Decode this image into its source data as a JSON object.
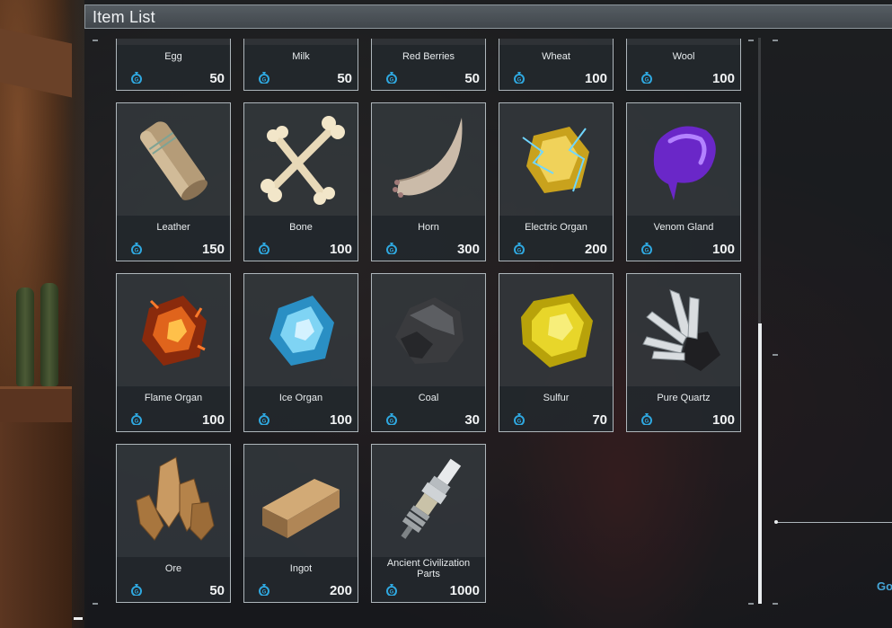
{
  "window": {
    "title": "Item List"
  },
  "colors": {
    "coin": "#2fa8e0",
    "card_border": "#aeb6bb",
    "text": "#e8ecee"
  },
  "right_panel": {
    "partial_text": "Go"
  },
  "items": [
    {
      "name": "Egg",
      "price": "50",
      "icon": "egg-icon"
    },
    {
      "name": "Milk",
      "price": "50",
      "icon": "milk-icon"
    },
    {
      "name": "Red Berries",
      "price": "50",
      "icon": "red-berries-icon"
    },
    {
      "name": "Wheat",
      "price": "100",
      "icon": "wheat-icon"
    },
    {
      "name": "Wool",
      "price": "100",
      "icon": "wool-icon"
    },
    {
      "name": "Leather",
      "price": "150",
      "icon": "leather-icon"
    },
    {
      "name": "Bone",
      "price": "100",
      "icon": "bone-icon"
    },
    {
      "name": "Horn",
      "price": "300",
      "icon": "horn-icon"
    },
    {
      "name": "Electric Organ",
      "price": "200",
      "icon": "electric-organ-icon"
    },
    {
      "name": "Venom Gland",
      "price": "100",
      "icon": "venom-gland-icon"
    },
    {
      "name": "Flame Organ",
      "price": "100",
      "icon": "flame-organ-icon"
    },
    {
      "name": "Ice Organ",
      "price": "100",
      "icon": "ice-organ-icon"
    },
    {
      "name": "Coal",
      "price": "30",
      "icon": "coal-icon"
    },
    {
      "name": "Sulfur",
      "price": "70",
      "icon": "sulfur-icon"
    },
    {
      "name": "Pure Quartz",
      "price": "100",
      "icon": "pure-quartz-icon"
    },
    {
      "name": "Ore",
      "price": "50",
      "icon": "ore-icon"
    },
    {
      "name": "Ingot",
      "price": "200",
      "icon": "ingot-icon"
    },
    {
      "name": "Ancient Civilization Parts",
      "price": "1000",
      "icon": "ancient-civilization-parts-icon"
    }
  ]
}
